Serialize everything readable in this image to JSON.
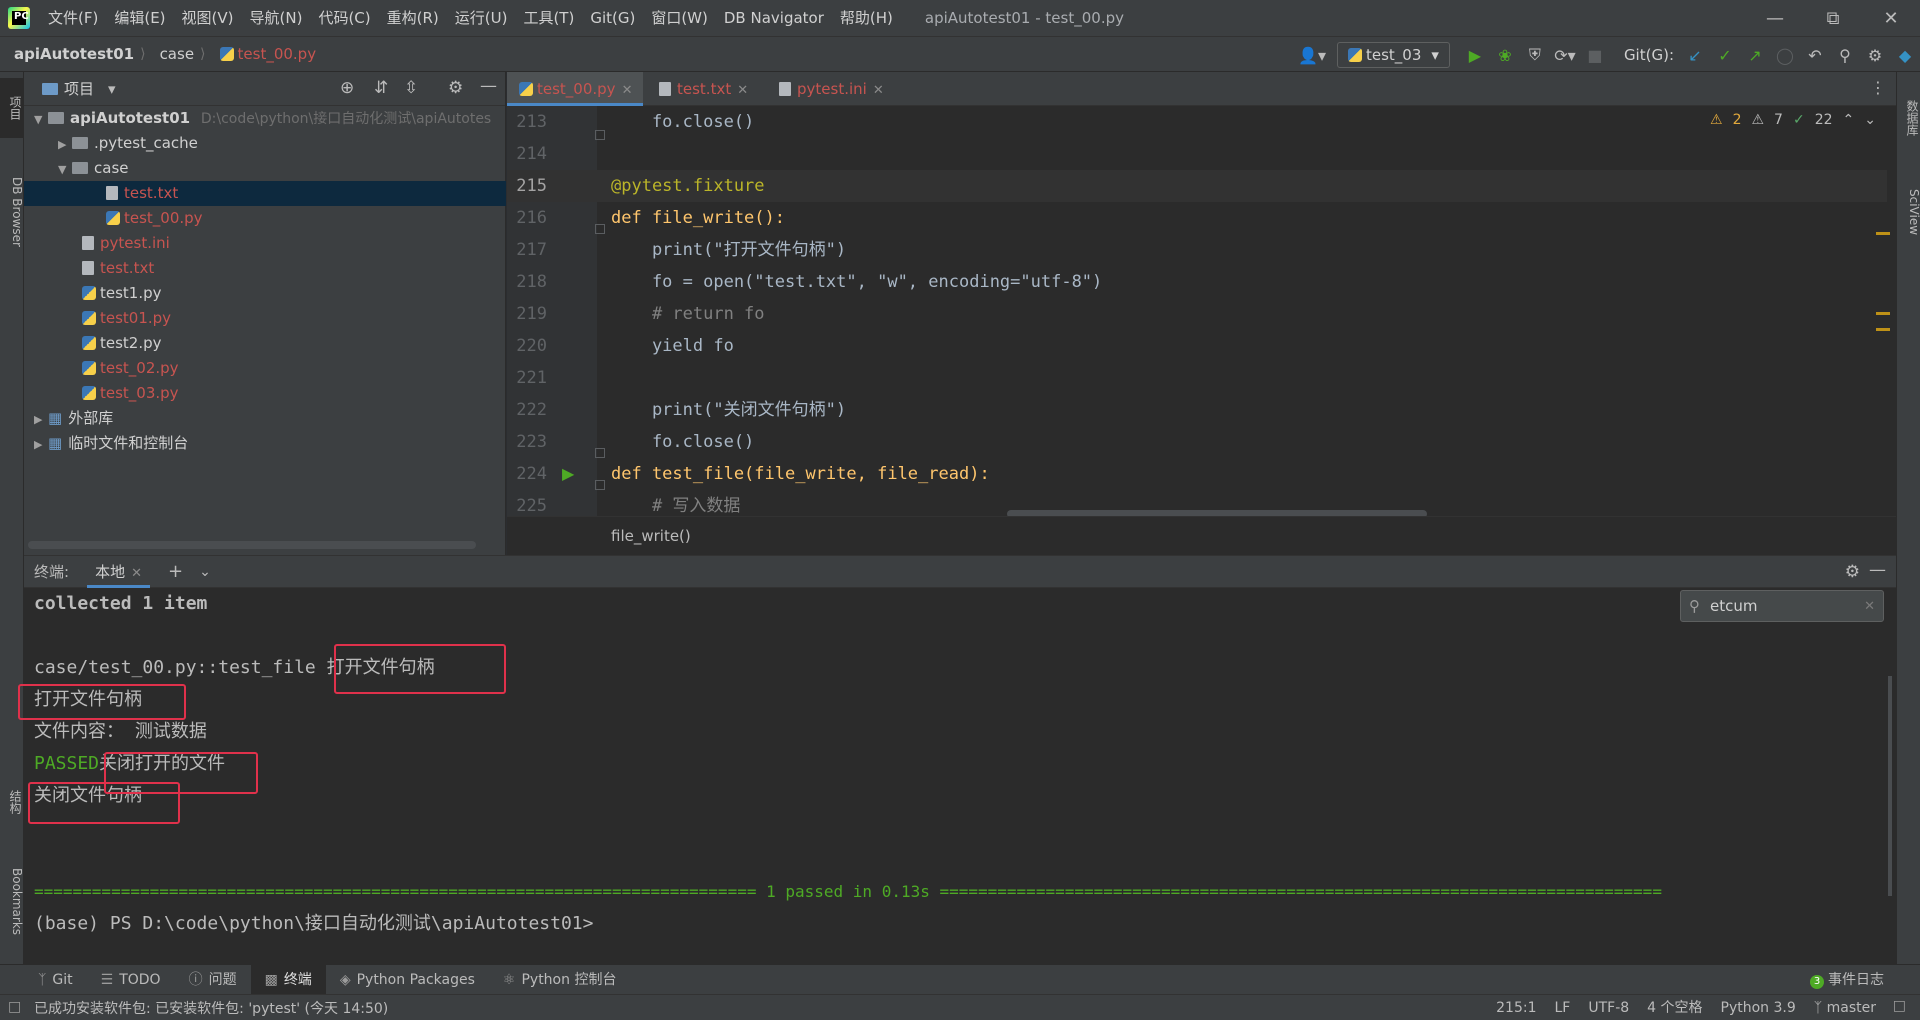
{
  "menu": {
    "items": [
      "文件(F)",
      "编辑(E)",
      "视图(V)",
      "导航(N)",
      "代码(C)",
      "重构(R)",
      "运行(U)",
      "工具(T)",
      "Git(G)",
      "窗口(W)",
      "DB Navigator",
      "帮助(H)"
    ],
    "window_title": "apiAutotest01 - test_00.py"
  },
  "navbar": {
    "project": "apiAutotest01",
    "folder": "case",
    "file": "test_00.py",
    "run_config": "test_03",
    "git_label": "Git(G):"
  },
  "left_stripe": {
    "project": "项目",
    "db_browser": "DB Browser",
    "structure": "结构",
    "bookmarks": "Bookmarks"
  },
  "right_stripe": {
    "database": "数据库",
    "sciview": "SciView"
  },
  "project_panel": {
    "title": "项目",
    "tree": [
      {
        "label": "apiAutotest01",
        "hint": "D:\\code\\python\\接口自动化测试\\apiAutotes"
      },
      {
        "label": ".pytest_cache"
      },
      {
        "label": "case"
      },
      {
        "label": "test.txt"
      },
      {
        "label": "test_00.py"
      },
      {
        "label": "pytest.ini"
      },
      {
        "label": "test.txt"
      },
      {
        "label": "test1.py"
      },
      {
        "label": "test01.py"
      },
      {
        "label": "test2.py"
      },
      {
        "label": "test_02.py"
      },
      {
        "label": "test_03.py"
      },
      {
        "label": "外部库"
      },
      {
        "label": "临时文件和控制台"
      }
    ]
  },
  "editor": {
    "tabs": [
      "test_00.py",
      "test.txt",
      "pytest.ini"
    ],
    "inspections": {
      "warnings": "2",
      "weak": "7",
      "ok": "22"
    },
    "lines": [
      {
        "n": "213",
        "text": "    fo.close()"
      },
      {
        "n": "214",
        "text": ""
      },
      {
        "n": "215",
        "text": "@pytest.fixture"
      },
      {
        "n": "216",
        "text": "def file_write():"
      },
      {
        "n": "217",
        "text": "    print(\"打开文件句柄\")"
      },
      {
        "n": "218",
        "text": "    fo = open(\"test.txt\", \"w\", encoding=\"utf-8\")"
      },
      {
        "n": "219",
        "text": "    # return fo"
      },
      {
        "n": "220",
        "text": "    yield fo"
      },
      {
        "n": "221",
        "text": ""
      },
      {
        "n": "222",
        "text": "    print(\"关闭文件句柄\")"
      },
      {
        "n": "223",
        "text": "    fo.close()"
      },
      {
        "n": "224",
        "text": "def test_file(file_write, file_read):"
      },
      {
        "n": "225",
        "text": "    # 写入数据"
      }
    ],
    "breadcrumb": "file_write()"
  },
  "terminal": {
    "title": "终端:",
    "tab": "本地",
    "search": "etcum",
    "lines": [
      "collected 1 item",
      "",
      "case/test_00.py::test_file 打开文件句柄",
      "打开文件句柄",
      "文件内容： 测试数据",
      "PASSED",
      "关闭打开的文件",
      "关闭文件句柄",
      "",
      "",
      "=========================================================================== 1 passed in 0.13s ===========================================================================",
      "(base) PS D:\\code\\python\\接口自动化测试\\apiAutotest01>"
    ]
  },
  "tool_windows": [
    "Git",
    "TODO",
    "问题",
    "终端",
    "Python Packages",
    "Python 控制台"
  ],
  "event_log": {
    "count": "3",
    "label": "事件日志"
  },
  "status": {
    "message": "已成功安装软件包: 已安装软件包: 'pytest' (今天 14:50)",
    "position": "215:1",
    "line_sep": "LF",
    "encoding": "UTF-8",
    "indent": "4 个空格",
    "interpreter": "Python 3.9",
    "branch": "master"
  },
  "colors": {
    "accent": "#4a88c7",
    "highlight_box": "#e0314b",
    "passed_green": "#4eaa25",
    "modified_file": "#c75450"
  }
}
